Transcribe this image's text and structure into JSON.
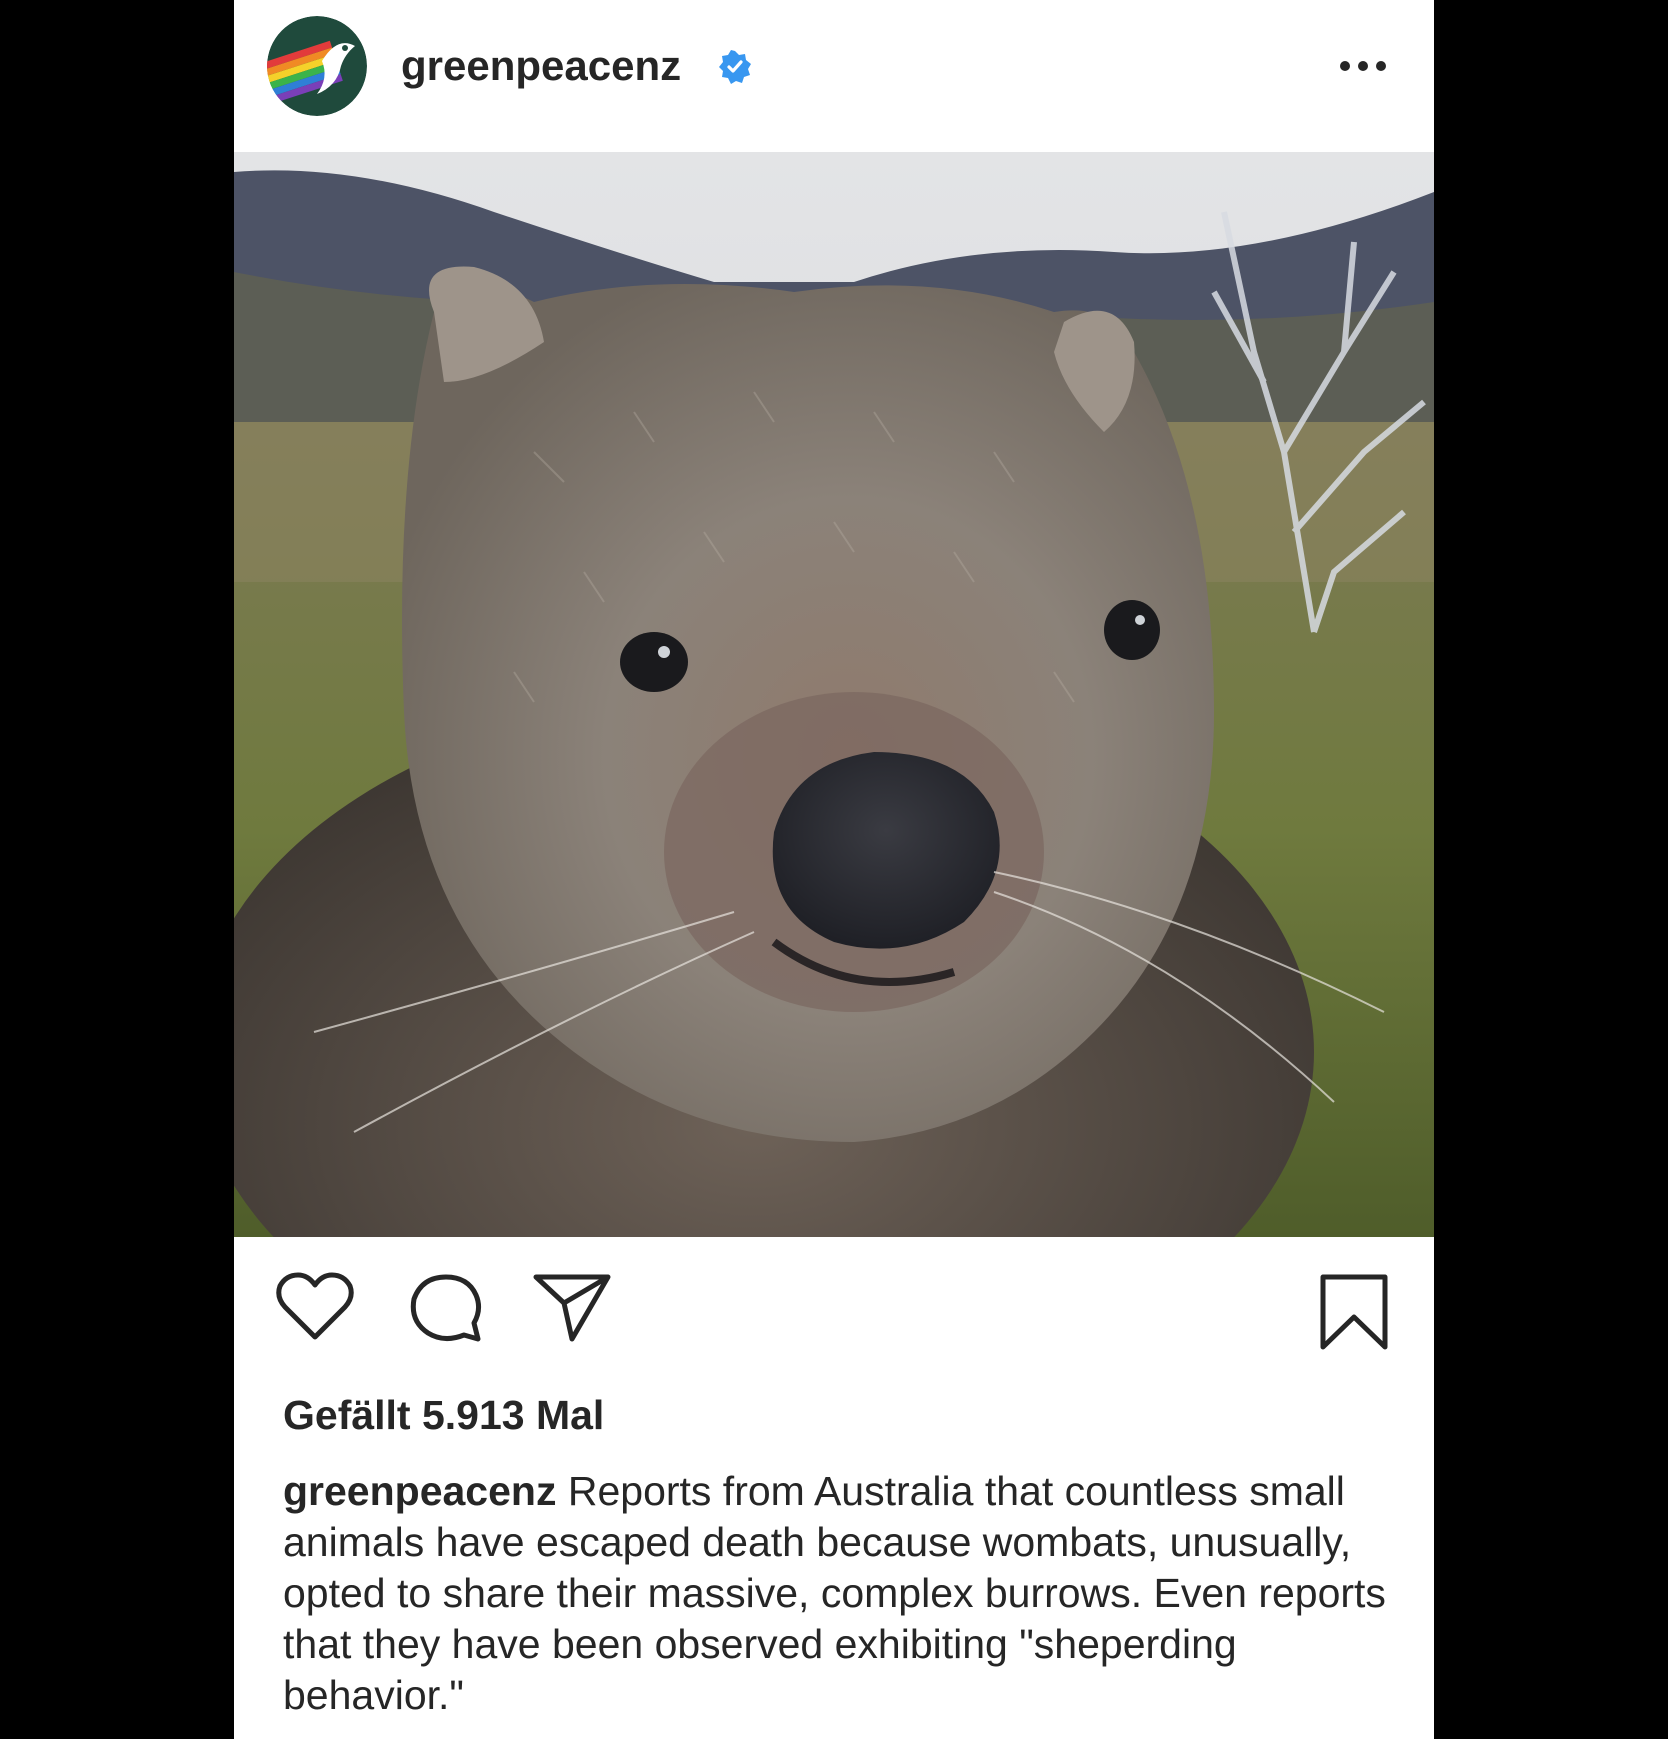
{
  "post": {
    "username": "greenpeacenz",
    "verified": true,
    "more_label": "More options",
    "likes_text": "Gefällt 5.913 Mal",
    "caption": {
      "username": "greenpeacenz",
      "text": "Reports from Australia that countless small animals have escaped death because wombats, unusually, opted to share their massive, complex burrows. Even reports that they have been observed exhibiting \"sheperding behavior.\""
    }
  },
  "colors": {
    "text": "#262626",
    "verified_badge": "#3897f0",
    "background": "#ffffff",
    "frame": "#000000"
  },
  "icons": [
    "heart-icon",
    "comment-icon",
    "share-icon",
    "bookmark-icon",
    "verified-badge-icon",
    "more-options-icon"
  ]
}
